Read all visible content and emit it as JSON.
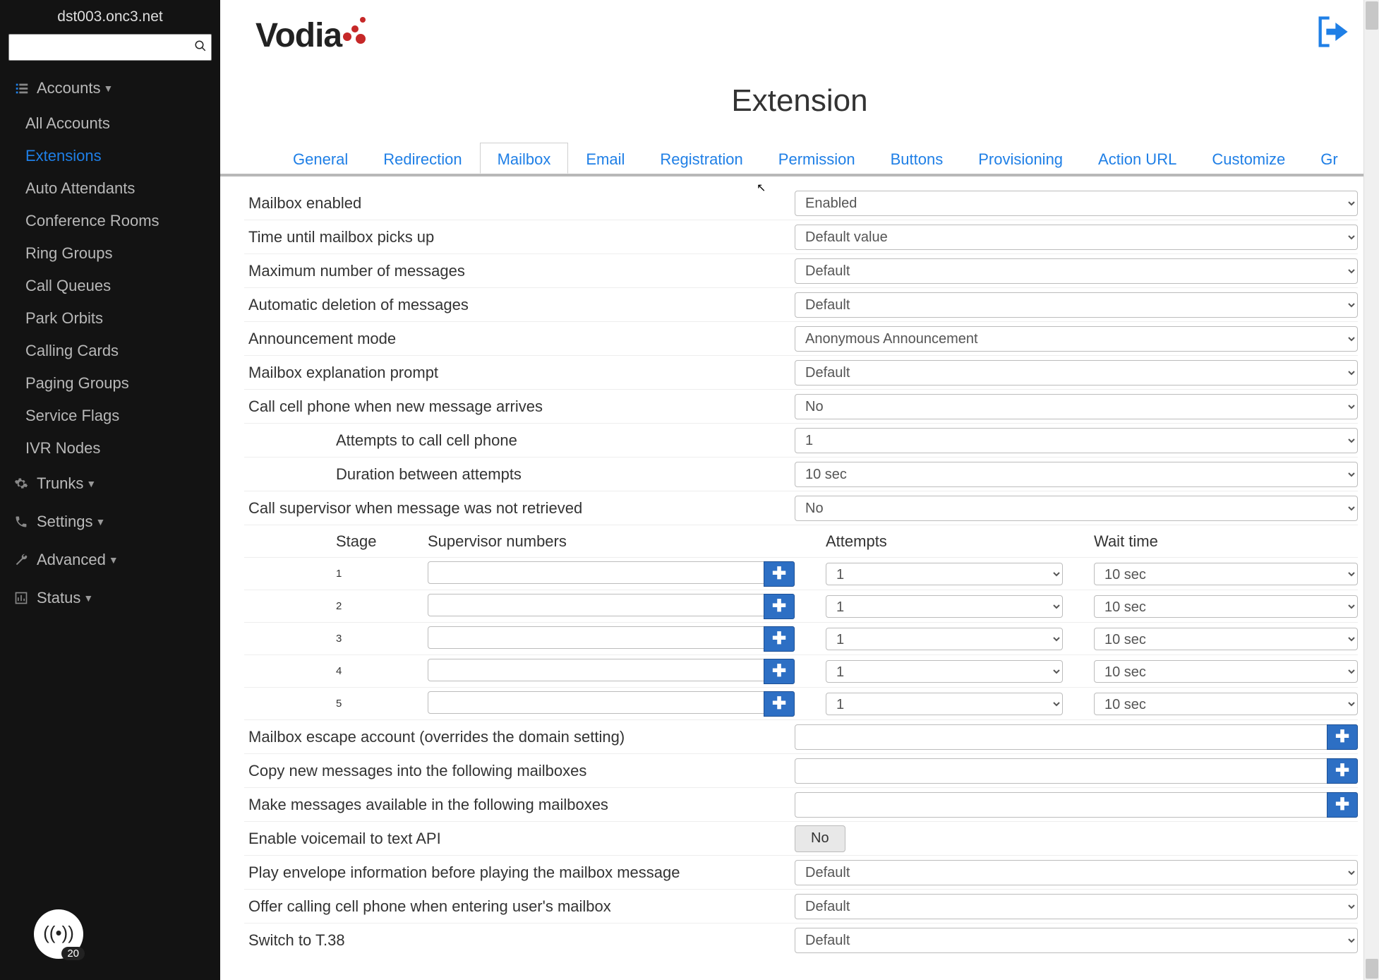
{
  "domain_host": "dst003.onc3.net",
  "logo_text": "Vodia",
  "page_title": "Extension",
  "search_placeholder": "",
  "sidebar": {
    "sections": [
      {
        "label": "Accounts",
        "expandable": true
      },
      {
        "label": "Trunks",
        "expandable": true
      },
      {
        "label": "Settings",
        "expandable": true
      },
      {
        "label": "Advanced",
        "expandable": true
      },
      {
        "label": "Status",
        "expandable": true
      }
    ],
    "accounts_items": [
      "All Accounts",
      "Extensions",
      "Auto Attendants",
      "Conference Rooms",
      "Ring Groups",
      "Call Queues",
      "Park Orbits",
      "Calling Cards",
      "Paging Groups",
      "Service Flags",
      "IVR Nodes"
    ],
    "active_sub": "Extensions",
    "badge_count": "20"
  },
  "tabs": [
    "General",
    "Redirection",
    "Mailbox",
    "Email",
    "Registration",
    "Permission",
    "Buttons",
    "Provisioning",
    "Action URL",
    "Customize",
    "Gr"
  ],
  "active_tab": "Mailbox",
  "form": {
    "mailbox_enabled": {
      "label": "Mailbox enabled",
      "value": "Enabled"
    },
    "pickup_time": {
      "label": "Time until mailbox picks up",
      "value": "Default value"
    },
    "max_messages": {
      "label": "Maximum number of messages",
      "value": "Default"
    },
    "auto_delete": {
      "label": "Automatic deletion of messages",
      "value": "Default"
    },
    "announcement_mode": {
      "label": "Announcement mode",
      "value": "Anonymous Announcement"
    },
    "explanation_prompt": {
      "label": "Mailbox explanation prompt",
      "value": "Default"
    },
    "call_cell_new": {
      "label": "Call cell phone when new message arrives",
      "value": "No"
    },
    "cell_attempts": {
      "label": "Attempts to call cell phone",
      "value": "1"
    },
    "cell_duration": {
      "label": "Duration between attempts",
      "value": "10 sec"
    },
    "call_supervisor": {
      "label": "Call supervisor when message was not retrieved",
      "value": "No"
    },
    "sup_headers": {
      "stage": "Stage",
      "numbers": "Supervisor numbers",
      "attempts": "Attempts",
      "wait": "Wait time"
    },
    "sup_rows": [
      {
        "stage": "1",
        "numbers": "",
        "attempts": "1",
        "wait": "10 sec"
      },
      {
        "stage": "2",
        "numbers": "",
        "attempts": "1",
        "wait": "10 sec"
      },
      {
        "stage": "3",
        "numbers": "",
        "attempts": "1",
        "wait": "10 sec"
      },
      {
        "stage": "4",
        "numbers": "",
        "attempts": "1",
        "wait": "10 sec"
      },
      {
        "stage": "5",
        "numbers": "",
        "attempts": "1",
        "wait": "10 sec"
      }
    ],
    "escape_account": {
      "label": "Mailbox escape account (overrides the domain setting)",
      "value": ""
    },
    "copy_into": {
      "label": "Copy new messages into the following mailboxes",
      "value": ""
    },
    "make_available": {
      "label": "Make messages available in the following mailboxes",
      "value": ""
    },
    "vm_text_api": {
      "label": "Enable voicemail to text API",
      "value": "No"
    },
    "play_envelope": {
      "label": "Play envelope information before playing the mailbox message",
      "value": "Default"
    },
    "offer_cell": {
      "label": "Offer calling cell phone when entering user's mailbox",
      "value": "Default"
    },
    "switch_t38": {
      "label": "Switch to T.38",
      "value": "Default"
    }
  }
}
